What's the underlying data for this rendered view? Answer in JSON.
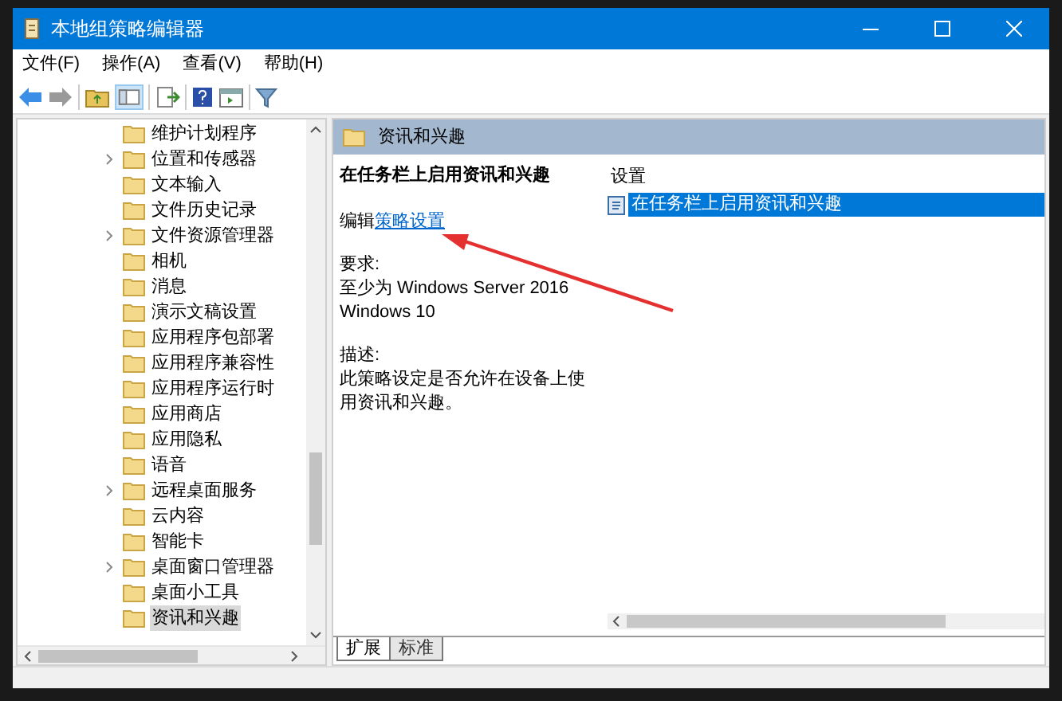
{
  "window": {
    "title": "本地组策略编辑器"
  },
  "menu": [
    "文件(F)",
    "操作(A)",
    "查看(V)",
    "帮助(H)"
  ],
  "tree": [
    {
      "label": "维护计划程序",
      "expandable": false,
      "selected": false
    },
    {
      "label": "位置和传感器",
      "expandable": true,
      "selected": false
    },
    {
      "label": "文本输入",
      "expandable": false,
      "selected": false
    },
    {
      "label": "文件历史记录",
      "expandable": false,
      "selected": false
    },
    {
      "label": "文件资源管理器",
      "expandable": true,
      "selected": false
    },
    {
      "label": "相机",
      "expandable": false,
      "selected": false
    },
    {
      "label": "消息",
      "expandable": false,
      "selected": false
    },
    {
      "label": "演示文稿设置",
      "expandable": false,
      "selected": false
    },
    {
      "label": "应用程序包部署",
      "expandable": false,
      "selected": false
    },
    {
      "label": "应用程序兼容性",
      "expandable": false,
      "selected": false
    },
    {
      "label": "应用程序运行时",
      "expandable": false,
      "selected": false
    },
    {
      "label": "应用商店",
      "expandable": false,
      "selected": false
    },
    {
      "label": "应用隐私",
      "expandable": false,
      "selected": false
    },
    {
      "label": "语音",
      "expandable": false,
      "selected": false
    },
    {
      "label": "远程桌面服务",
      "expandable": true,
      "selected": false
    },
    {
      "label": "云内容",
      "expandable": false,
      "selected": false
    },
    {
      "label": "智能卡",
      "expandable": false,
      "selected": false
    },
    {
      "label": "桌面窗口管理器",
      "expandable": true,
      "selected": false
    },
    {
      "label": "桌面小工具",
      "expandable": false,
      "selected": false
    },
    {
      "label": "资讯和兴趣",
      "expandable": false,
      "selected": true
    }
  ],
  "details": {
    "header": "资讯和兴趣",
    "setting_title": "在任务栏上启用资讯和兴趣",
    "edit_prefix": "编辑",
    "edit_link": "策略设置",
    "requirements_label": "要求:",
    "requirements": [
      "至少为 Windows Server 2016",
      "Windows 10"
    ],
    "description_label": "描述:",
    "description": "此策略设定是否允许在设备上使用资讯和兴趣。"
  },
  "settings": {
    "column": "设置",
    "rows": [
      {
        "label": "在任务栏上启用资讯和兴趣",
        "selected": true
      }
    ]
  },
  "tabs": [
    {
      "label": "扩展",
      "selected": true
    },
    {
      "label": "标准",
      "selected": false
    }
  ]
}
